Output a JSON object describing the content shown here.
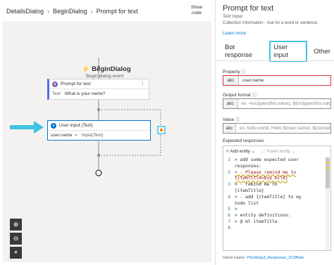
{
  "breadcrumb": [
    "DetailsDialog",
    "BeginDialog",
    "Prompt for text"
  ],
  "show_code": "Show code",
  "flow": {
    "title": "BeginDialog",
    "subtitle": "Begin dialog event",
    "prompt_node": {
      "title": "Prompt for text",
      "field_key": "Text",
      "field_value": "What is your name?"
    },
    "user_node": {
      "title": "User input (Text)",
      "field_key": "user.name",
      "field_op": "=",
      "field_value": "Input(Text)"
    }
  },
  "canvas_controls": {
    "zoom_in": "zoom-in-icon",
    "zoom_out": "zoom-out-icon",
    "fit": "focus-icon"
  },
  "panel": {
    "title": "Prompt for text",
    "type": "Text Input",
    "description": "Collection information - Ask for a word or sentence.",
    "learn_more": "Learn more",
    "tabs": [
      "Bot response",
      "User input",
      "Other"
    ],
    "active_tab": "User input",
    "property": {
      "label": "Property",
      "prefix": "abc",
      "value": "user.name"
    },
    "output_format": {
      "label": "Output format",
      "prefix": "abc",
      "placeholder": "ex. =toUpper(this.value), ${toUpper(this.value)}"
    },
    "value": {
      "label": "Value",
      "prefix": "abc",
      "placeholder": "ex. hello world, Hello ${user.name}, ${concat(user.first..."
    },
    "expected_responses": {
      "label": "Expected responses",
      "add_entity": "Add entity",
      "insert_entity": "Insert entity",
      "lines": [
        {
          "n": "1",
          "text": "> add some expected user"
        },
        {
          "n": "",
          "text": "responses:"
        },
        {
          "n": "2",
          "text": "> - Please remind me to"
        },
        {
          "n": "",
          "text": "{itemTitle=buy milk}"
        },
        {
          "n": "3",
          "text": "> - remind me to"
        },
        {
          "n": "",
          "text": "{itemTitle}"
        },
        {
          "n": "4",
          "text": "> - add {itemTitle} to my"
        },
        {
          "n": "",
          "text": "todo list"
        },
        {
          "n": "5",
          "text": ">"
        },
        {
          "n": "6",
          "text": "> entity definitions:"
        },
        {
          "n": "7",
          "text": "> @ ml itemTitle"
        },
        {
          "n": "8",
          "text": ""
        }
      ]
    },
    "intent_label": "Intent name:",
    "intent_value": "#TextInput_Response_2C6f6de"
  },
  "colors": {
    "accent": "#0078d4",
    "highlight_arrow": "#40c4e0",
    "error_border": "#d13438",
    "canvas_bg": "#f3f2f1"
  }
}
